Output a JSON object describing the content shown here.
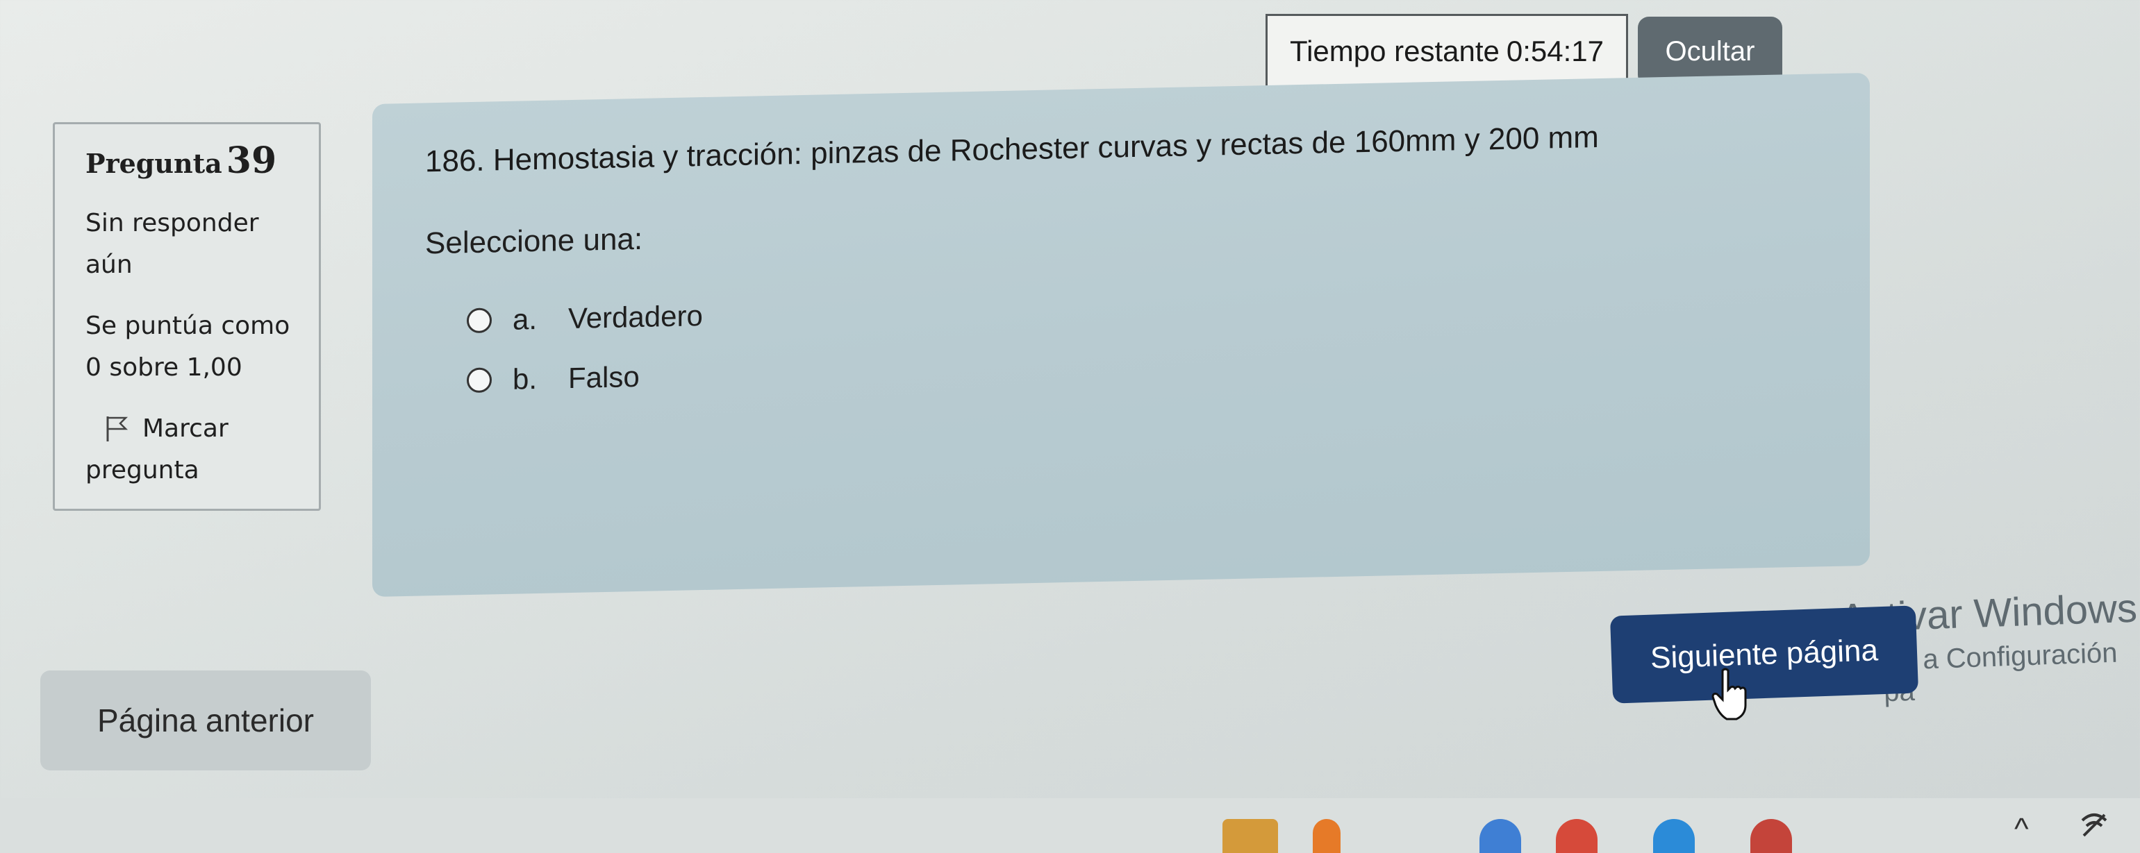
{
  "timer": {
    "label": "Tiempo restante",
    "value": "0:54:17"
  },
  "hide_button": "Ocultar",
  "question_info": {
    "title": "Pregunta",
    "number": "39",
    "status_line1": "Sin responder",
    "status_line2": "aún",
    "score_line1": "Se puntúa como",
    "score_line2": "0 sobre 1,00",
    "flag_label_line1": "Marcar",
    "flag_label_line2": "pregunta",
    "flag_icon": "flag-icon"
  },
  "question": {
    "text": "186. Hemostasia y tracción: pinzas de Rochester curvas y rectas de 160mm y 200 mm",
    "prompt": "Seleccione una:",
    "options": [
      {
        "letter": "a.",
        "label": "Verdadero"
      },
      {
        "letter": "b.",
        "label": "Falso"
      }
    ]
  },
  "navigation": {
    "next_label": "Siguiente página",
    "prev_label": "Página anterior"
  },
  "watermark": {
    "line1": "Activar Windows",
    "line2": "Ve a Configuración pa"
  },
  "colors": {
    "next_button": "#1e3f73",
    "hide_button": "#5f6a70",
    "content_panel": "#b8cbd1"
  }
}
